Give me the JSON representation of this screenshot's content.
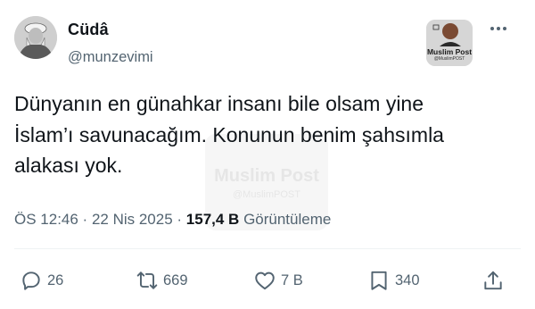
{
  "author": {
    "name": "Cüdâ",
    "handle": "@munzevimi"
  },
  "badge": {
    "title": "Muslim Post",
    "subtitle": "@MuslimPOST"
  },
  "watermark": {
    "title": "Muslim Post",
    "subtitle": "@MuslimPOST"
  },
  "tweet": {
    "text": "Dünyanın en günahkar insanı bile olsam yine\nİslam’ı savunacağım. Konunun benim şahsımla\nalakası yok."
  },
  "meta": {
    "time": "ÖS 12:46",
    "separator": " · ",
    "date": "22 Nis 2025",
    "views_value": "157,4 B",
    "views_label": "Görüntüleme"
  },
  "actions": {
    "replies": "26",
    "reposts": "669",
    "likes": "7 B",
    "bookmarks": "340"
  },
  "icons": [
    "more-icon",
    "reply-icon",
    "repost-icon",
    "like-icon",
    "bookmark-icon",
    "share-icon"
  ]
}
